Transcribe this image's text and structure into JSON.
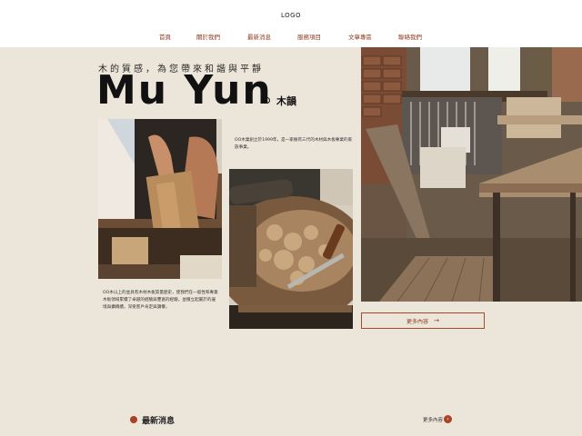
{
  "header": {
    "logo": "LOGO",
    "nav": [
      {
        "label": "首頁"
      },
      {
        "label": "關於我們"
      },
      {
        "label": "最新消息"
      },
      {
        "label": "服務項目"
      },
      {
        "label": "文章專區"
      },
      {
        "label": "聯絡我們"
      }
    ]
  },
  "hero": {
    "tagline": "木的質感，為您帶來和諧與平靜",
    "brand": "Mu Yun",
    "brand_sub": "木韻"
  },
  "intro": {
    "paragraph_1": "OO木業創立於1999年，是一家擁有三代的木材與木板專業的家族事業。",
    "paragraph_2": "OO木以上的並具有木材木板質量歷史，使我們在一般性和專業木板領域累積了卓越的經驗與豐富的經驗，並穩立起屬於的邊境與擴橋續，深受客戶肯定與讚譽。",
    "more_button": "更多內容",
    "more_arrow": "→"
  },
  "news": {
    "title": "最新消息",
    "more_label": "更多內容",
    "more_arrow": "›"
  },
  "colors": {
    "accent": "#a84424",
    "background": "#ece6da",
    "nav_text": "#8a3a1e"
  }
}
